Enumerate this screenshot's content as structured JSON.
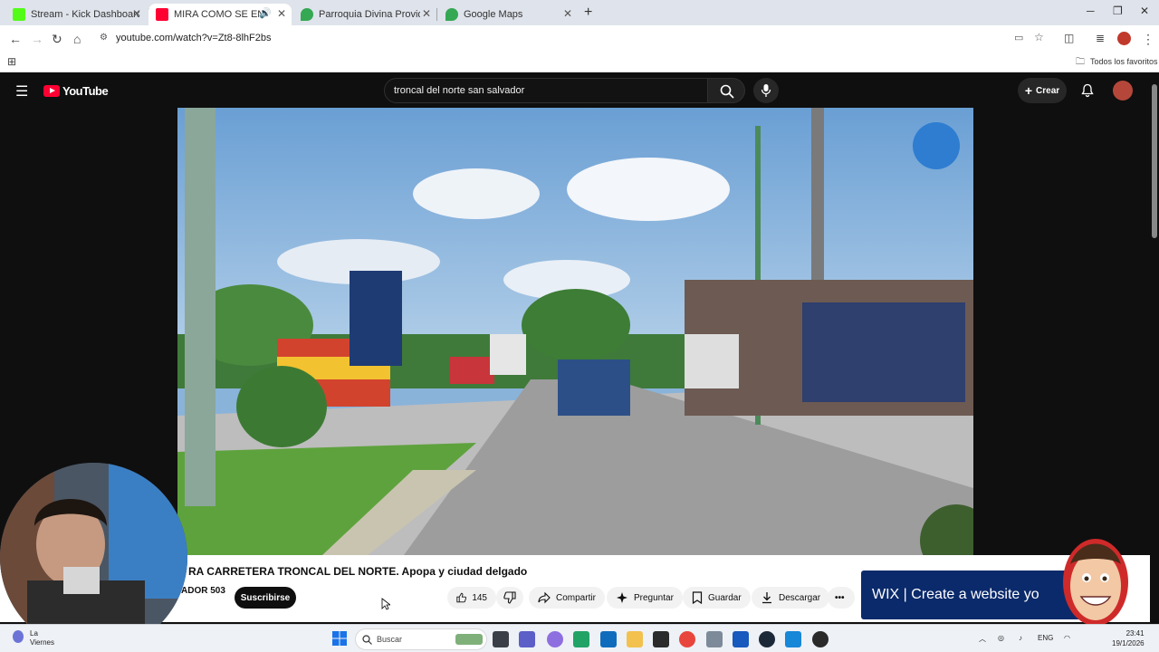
{
  "browser": {
    "tabs": [
      {
        "title": "Stream - Kick Dashboard",
        "favicon_color": "#53fc18",
        "active": false
      },
      {
        "title": "MIRA COMO SE ENCUENTR",
        "favicon_color": "#ff0033",
        "active": true
      },
      {
        "title": "Parroquia Divina Providencia - (",
        "favicon_color": "#34a853",
        "active": false
      },
      {
        "title": "Google Maps",
        "favicon_color": "#34a853",
        "active": false
      }
    ],
    "url": "youtube.com/watch?v=Zt8-8lhF2bs",
    "bookmarks_folder": "Todos los favoritos"
  },
  "youtube": {
    "logo": "YouTube",
    "search_query": "troncal del norte san salvador",
    "create_label": "Crear",
    "video": {
      "title": "RA CARRETERA TRONCAL DEL NORTE. Apopa y ciudad delgado",
      "channel_partial": "ADOR 503",
      "subscribe_label": "Suscribirse",
      "likes": "145",
      "share_label": "Compartir",
      "ask_label": "Preguntar",
      "save_label": "Guardar",
      "download_label": "Descargar"
    },
    "ad_text": "WIX | Create a website yo"
  },
  "taskbar": {
    "search_placeholder": "Buscar",
    "weather_line1": "La",
    "weather_line2": "Viernes",
    "language": "ENG",
    "time": "23:41",
    "date": "19/1/2026"
  },
  "colors": {
    "youtube_red": "#ff0033",
    "yt_dark": "#0f0f0f",
    "chrome_tabbar": "#dfe3eb"
  }
}
